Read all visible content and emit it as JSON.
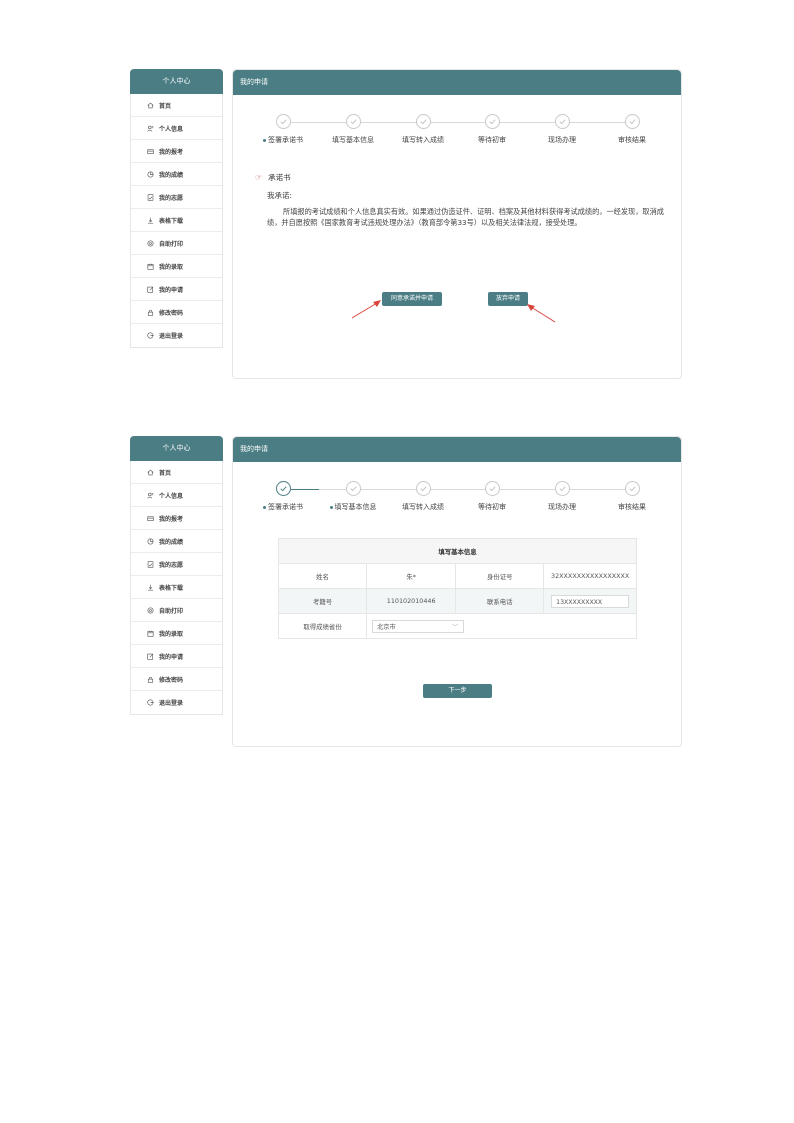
{
  "sidebar": {
    "title": "个人中心",
    "items": [
      {
        "label": "首页",
        "icon": "home-icon"
      },
      {
        "label": "个人信息",
        "icon": "user-icon"
      },
      {
        "label": "我的报考",
        "icon": "card-icon"
      },
      {
        "label": "我的成绩",
        "icon": "pie-chart-icon"
      },
      {
        "label": "我的志愿",
        "icon": "document-icon"
      },
      {
        "label": "表格下载",
        "icon": "download-icon"
      },
      {
        "label": "自助打印",
        "icon": "printer-icon"
      },
      {
        "label": "我的录取",
        "icon": "calendar-icon"
      },
      {
        "label": "我的申请",
        "icon": "edit-icon"
      },
      {
        "label": "修改密码",
        "icon": "lock-icon"
      },
      {
        "label": "退出登录",
        "icon": "logout-icon"
      }
    ]
  },
  "main": {
    "title": "我的申请"
  },
  "steps": [
    "签署承诺书",
    "填写基本信息",
    "填写转入成绩",
    "等待初审",
    "现场办理",
    "审核结果"
  ],
  "promise": {
    "title": "承诺书",
    "subtitle": "我承诺:",
    "body": "所填报的考试成绩和个人信息真实有效。如果通过伪造证件、证明、档案及其他材料获得考试成绩的，一经发现，取消成绩，并自愿按照《国家教育考试违规处理办法》（教育部令第33号）以及相关法律法规，接受处理。",
    "agree_label": "同意承诺并申请",
    "abandon_label": "放弃申请"
  },
  "form": {
    "title": "填写基本信息",
    "name_label": "姓名",
    "name_value": "朱*",
    "id_label": "身份证号",
    "id_value": "32XXXXXXXXXXXXXXXX",
    "exam_no_label": "考籍号",
    "exam_no_value": "110102010446",
    "phone_label": "联系电话",
    "phone_value": "13XXXXXXXXX",
    "province_label": "取得成绩省份",
    "province_value": "北京市",
    "next_label": "下一步"
  },
  "colors": {
    "accent": "#4a7d84",
    "arrow": "#d9453b"
  }
}
